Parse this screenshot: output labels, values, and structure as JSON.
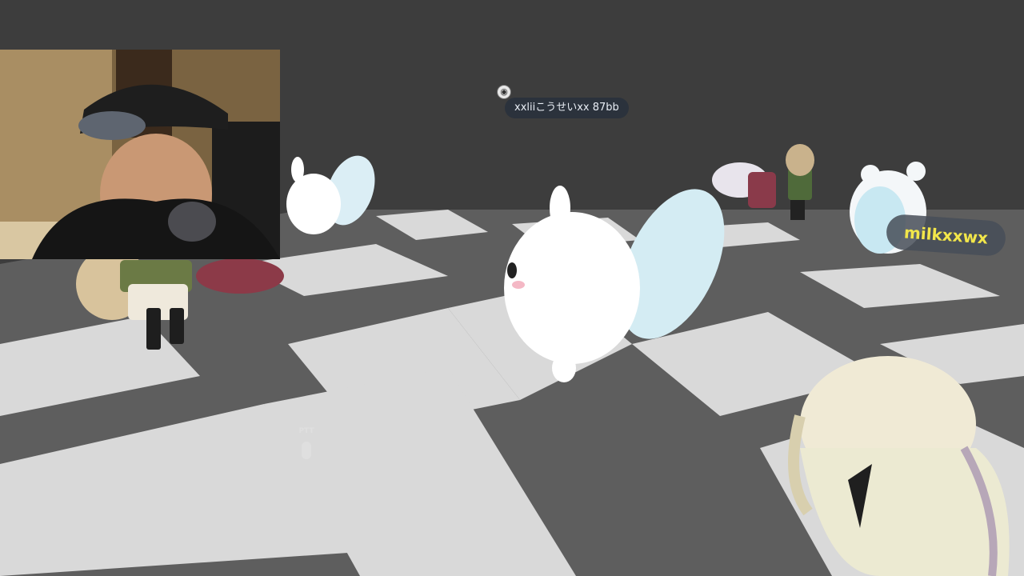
{
  "players": [
    {
      "name": "xxliiこうせいxx 87bb"
    },
    {
      "name": "milkxxwx"
    }
  ],
  "hud": {
    "ptt_label": "PTT",
    "ptt_icon": "microphone-icon",
    "nameplate_icon": "avatar-status-icon"
  }
}
